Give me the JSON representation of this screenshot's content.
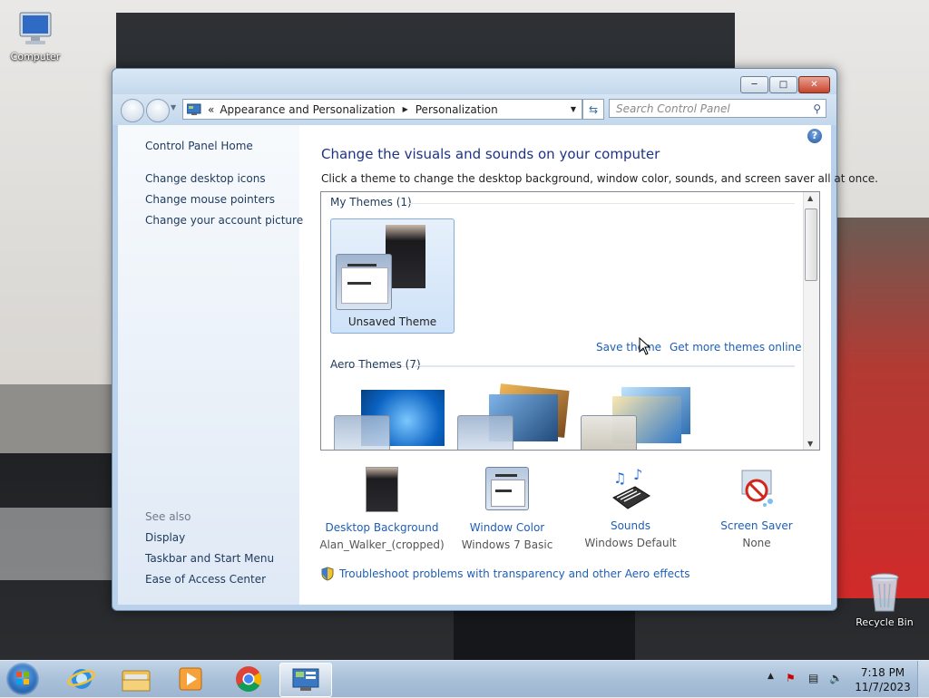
{
  "desktop": {
    "icons": [
      {
        "label": "Computer"
      },
      {
        "label": "Recycle Bin"
      }
    ]
  },
  "window": {
    "breadcrumb": {
      "prefix": "«",
      "items": [
        "Appearance and Personalization",
        "Personalization"
      ]
    },
    "search_placeholder": "Search Control Panel",
    "left_pane": {
      "home_link": "Control Panel Home",
      "links": [
        "Change desktop icons",
        "Change mouse pointers",
        "Change your account picture"
      ],
      "see_also_label": "See also",
      "see_also": [
        "Display",
        "Taskbar and Start Menu",
        "Ease of Access Center"
      ]
    },
    "main": {
      "title": "Change the visuals and sounds on your computer",
      "subtitle": "Click a theme to change the desktop background, window color, sounds, and screen saver all at once.",
      "my_themes_label": "My Themes (1)",
      "selected_theme": "Unsaved Theme",
      "save_theme_link": "Save theme",
      "get_more_link": "Get more themes online",
      "aero_themes_label": "Aero Themes (7)",
      "bottom_items": [
        {
          "label": "Desktop Background",
          "value": "Alan_Walker_(cropped)",
          "icon": "desktop-background-icon"
        },
        {
          "label": "Window Color",
          "value": "Windows 7 Basic",
          "icon": "window-color-icon"
        },
        {
          "label": "Sounds",
          "value": "Windows Default",
          "icon": "sounds-icon"
        },
        {
          "label": "Screen Saver",
          "value": "None",
          "icon": "screen-saver-icon"
        }
      ],
      "troubleshoot_link": "Troubleshoot problems with transparency and other Aero effects"
    }
  },
  "taskbar": {
    "apps": [
      "internet-explorer",
      "windows-explorer",
      "media-player",
      "chrome",
      "control-panel"
    ],
    "time": "7:18 PM",
    "date": "11/7/2023"
  }
}
